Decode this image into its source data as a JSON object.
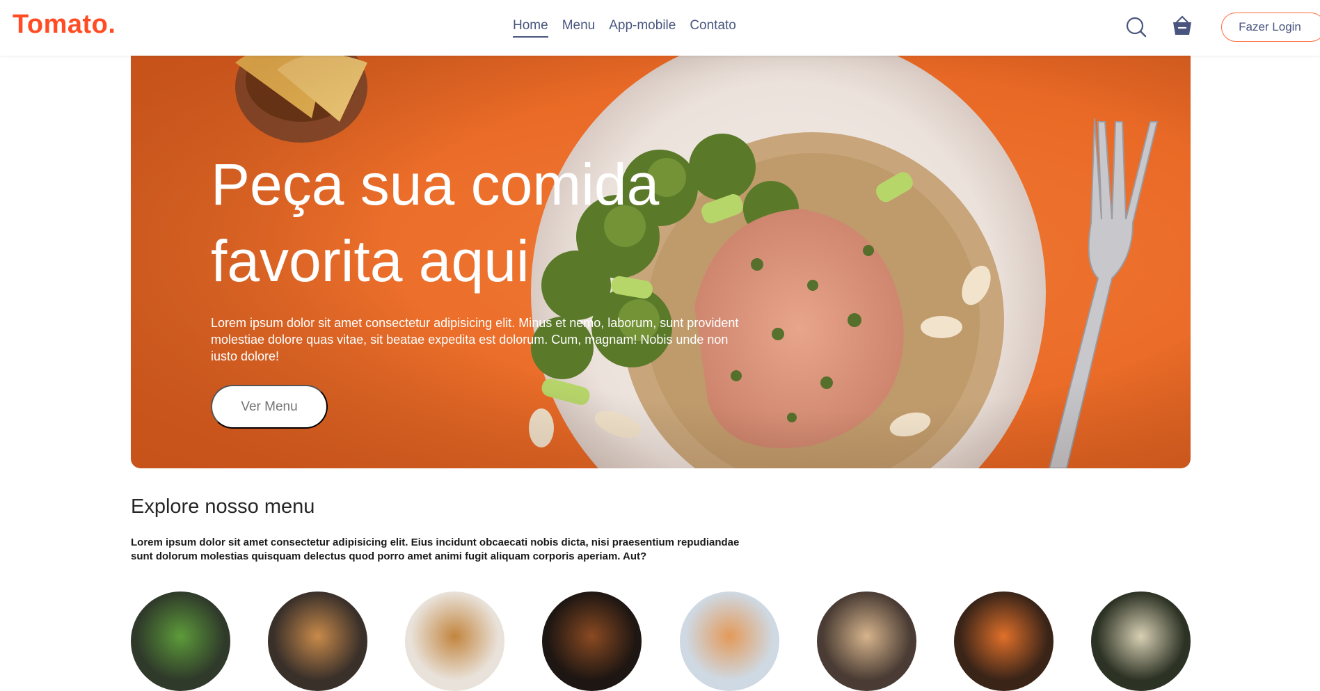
{
  "brand": {
    "logo_text": "Tomato.",
    "accent": "#ff4c24"
  },
  "nav": {
    "links": [
      {
        "label": "Home",
        "active": true
      },
      {
        "label": "Menu",
        "active": false
      },
      {
        "label": "App-mobile",
        "active": false
      },
      {
        "label": "Contato",
        "active": false
      }
    ],
    "text_color": "#49557e"
  },
  "header_actions": {
    "search_icon": "search-icon",
    "basket_icon": "basket-icon",
    "login_label": "Fazer Login"
  },
  "hero": {
    "title": "Peça sua comida favorita aqui",
    "text": "Lorem ipsum dolor sit amet consectetur adipisicing elit. Minus et nemo, laborum, sunt provident molestiae dolore quas vitae, sit beatae expedita est dolorum. Cum, magnam! Nobis unde non iusto dolore!",
    "button_label": "Ver Menu",
    "background": "#ea6b27"
  },
  "explore": {
    "title": "Explore nosso menu",
    "text": "Lorem ipsum dolor sit amet consectetur adipisicing elit. Eius incidunt obcaecati nobis dicta, nisi praesentium repudiandae sunt dolorum molestias quisquam delectus quod porro amet animi fugit aliquam corporis aperiam. Aut?",
    "items": [
      {
        "color": "#2f3a2a",
        "accent": "#5d9b3a"
      },
      {
        "color": "#3a302a",
        "accent": "#c88a4a"
      },
      {
        "color": "#e9e2da",
        "accent": "#c2853e"
      },
      {
        "color": "#1e1612",
        "accent": "#8a4a22"
      },
      {
        "color": "#cfd9e3",
        "accent": "#e39a5a"
      },
      {
        "color": "#4a3c34",
        "accent": "#d6b48c"
      },
      {
        "color": "#3a2418",
        "accent": "#e0702a"
      },
      {
        "color": "#2c3224",
        "accent": "#d8d0b4"
      }
    ]
  }
}
